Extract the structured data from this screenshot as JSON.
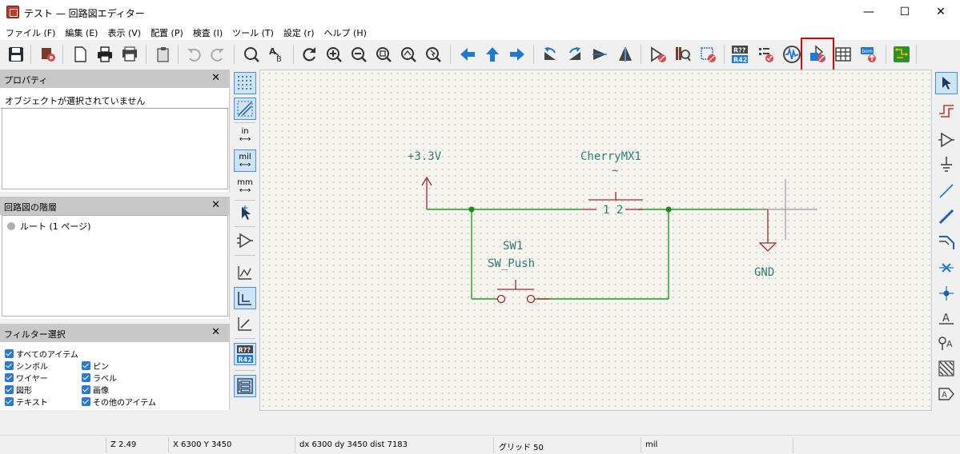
{
  "window": {
    "title": "テスト — 回路図エディター",
    "minimize_glyph": "—",
    "maximize_glyph": "☐",
    "close_glyph": "✕"
  },
  "menu": [
    "ファイル (F)",
    "編集 (E)",
    "表示 (V)",
    "配置 (P)",
    "検査 (I)",
    "ツール (T)",
    "設定 (r)",
    "ヘルプ (H)"
  ],
  "toolbar_icons": [
    "save-icon",
    "schematic-setup-icon",
    "new-page-icon",
    "print-icon",
    "plot-icon",
    "paste-icon",
    "undo-icon",
    "redo-icon",
    "find-icon",
    "find-replace-icon",
    "refresh-icon",
    "zoom-in-icon",
    "zoom-out-icon",
    "zoom-fit-icon",
    "zoom-objects-icon",
    "zoom-tool-icon",
    "navigate-back-icon",
    "navigate-up-icon",
    "navigate-forward-icon",
    "rotate-ccw-icon",
    "rotate-cw-icon",
    "mirror-vertical-icon",
    "mirror-horizontal-icon",
    "symbol-editor-icon",
    "symbol-library-browser-icon",
    "footprint-assign-icon",
    "annotate-icon",
    "erc-icon",
    "simulator-icon",
    "generate-netlist-icon",
    "bom-table-icon",
    "bom-export-icon",
    "pcb-editor-icon"
  ],
  "highlighted_toolbar_icon": "generate-netlist-icon",
  "panels": {
    "properties": {
      "title": "プロパティ",
      "message": "オブジェクトが選択されていません",
      "close": "✕"
    },
    "hierarchy": {
      "title": "回路図の階層",
      "root": "ルート (1 ページ)",
      "close": "✕"
    },
    "filter": {
      "title": "フィルター選択",
      "close": "✕",
      "items": [
        {
          "label": "すべてのアイテム",
          "checked": true
        },
        {
          "label": "シンボル",
          "checked": true
        },
        {
          "label": "ピン",
          "checked": true
        },
        {
          "label": "ワイヤー",
          "checked": true
        },
        {
          "label": "ラベル",
          "checked": true
        },
        {
          "label": "図形",
          "checked": true
        },
        {
          "label": "画像",
          "checked": true
        },
        {
          "label": "テキスト",
          "checked": true
        },
        {
          "label": "その他のアイテム",
          "checked": true
        }
      ]
    }
  },
  "left_tools": {
    "units_in": "in",
    "units_mil": "mil",
    "units_mm": "mm",
    "annotate_badge_top": "R??",
    "annotate_badge_bottom": "R42"
  },
  "schematic": {
    "power_3v3": "+3.3V",
    "gnd": "GND",
    "cherry_ref": "CherryMX1",
    "cherry_value": "~",
    "cherry_pins": "1 2",
    "sw1_ref": "SW1",
    "sw1_value": "SW_Push",
    "colors": {
      "wire": "#1aa31a",
      "symbol": "#9c2a2a",
      "text": "#2e7b78",
      "junction": "#1a8a1a"
    }
  },
  "status": {
    "zoom": "Z 2.49",
    "xy": "X 6300  Y 3450",
    "delta": "dx 6300  dy 3450  dist 7183",
    "grid": "グリッド 50",
    "units": "mil"
  },
  "colors": {
    "accent": "#2b79d0",
    "highlight": "#e00000"
  }
}
